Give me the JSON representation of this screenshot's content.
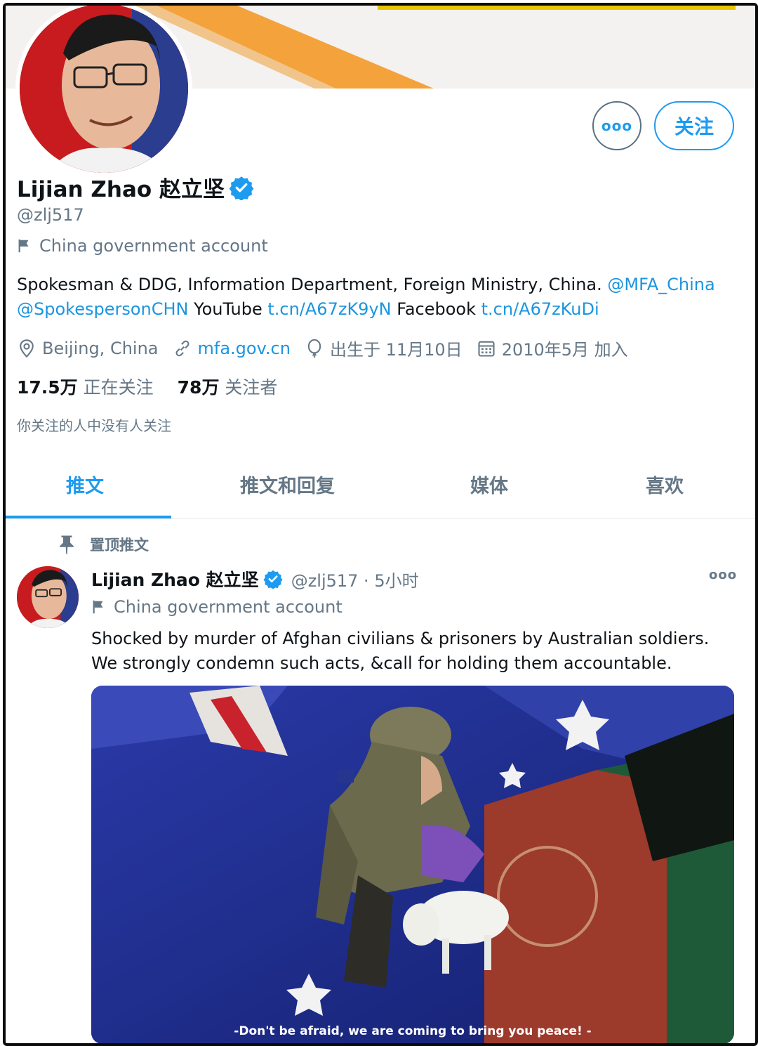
{
  "profile": {
    "name": "Lijian Zhao 赵立坚",
    "handle": "@zlj517",
    "account_label": "China government account",
    "bio": {
      "text1": "Spokesman & DDG, Information Department, Foreign Ministry, China. ",
      "mention1": "@MFA_China",
      "mention2": "@SpokespersonCHN",
      "text2": " YouTube ",
      "link1": "t.cn/A67zK9yN",
      "text3": " Facebook ",
      "link2": "t.cn/A67zKuDi"
    },
    "location": "Beijing, China",
    "website": "mfa.gov.cn",
    "birthday": "出生于 11月10日",
    "joined": "2010年5月 加入",
    "following_count": "17.5万",
    "following_label": "正在关注",
    "followers_count": "78万",
    "followers_label": "关注者",
    "followed_by_note": "你关注的人中没有人关注"
  },
  "actions": {
    "more_label": "ooo",
    "follow_label": "关注"
  },
  "tabs": [
    {
      "label": "推文"
    },
    {
      "label": "推文和回复"
    },
    {
      "label": "媒体"
    },
    {
      "label": "喜欢"
    }
  ],
  "pinned": {
    "label": "置顶推文",
    "author_name": "Lijian Zhao 赵立坚",
    "handle": "@zlj517 · 5小时",
    "account_label": "China government account",
    "more_label": "ooo",
    "text": "Shocked by murder of Afghan civilians & prisoners by Australian soldiers. We strongly condemn such acts, &call for holding them accountable.",
    "image_caption": "-Don't be afraid,  we are coming to bring you peace!  -"
  },
  "colors": {
    "accent": "#1d9bf0",
    "secondary_text": "#657786",
    "link": "#1b95e0"
  }
}
